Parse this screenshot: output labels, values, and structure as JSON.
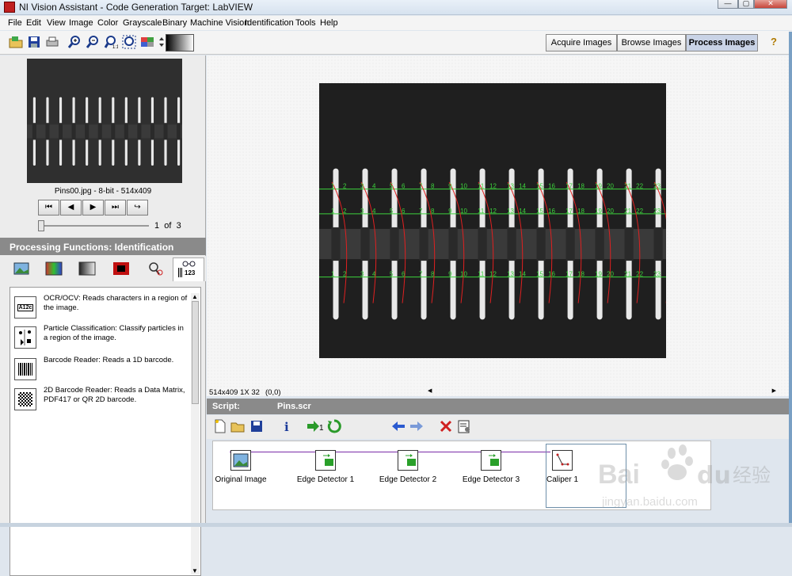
{
  "window": {
    "title": "NI Vision Assistant - Code Generation Target: LabVIEW",
    "min": "—",
    "max": "▢",
    "close": "✕"
  },
  "menu": [
    "File",
    "Edit",
    "View",
    "Image",
    "Color",
    "Grayscale",
    "Binary",
    "Machine Vision",
    "Identification",
    "Tools",
    "Help"
  ],
  "modes": {
    "acquire": "Acquire Images",
    "browse": "Browse Images",
    "process": "Process Images",
    "help": "?"
  },
  "thumbnail": {
    "caption": "Pins00.jpg - 8-bit - 514x409",
    "page_current": "1",
    "page_of": "of",
    "page_total": "3"
  },
  "processing": {
    "header": "Processing Functions: Identification",
    "tab_barcode_label": "123"
  },
  "functions": [
    {
      "icon_label": "A12c",
      "text": "OCR/OCV:  Reads characters in a region of the image."
    },
    {
      "icon_label": "",
      "text": "Particle Classification:  Classify particles in a region of the image."
    },
    {
      "icon_label": "",
      "text": "Barcode Reader:  Reads a 1D barcode."
    },
    {
      "icon_label": "",
      "text": "2D Barcode Reader:  Reads a Data Matrix, PDF417 or QR 2D barcode."
    }
  ],
  "image_status": {
    "info": "514x409 1X 32",
    "coords": "(0,0)"
  },
  "script": {
    "label": "Script:",
    "file": "Pins.scr",
    "step_counter_label": "1"
  },
  "steps": [
    "Original Image",
    "Edge Detector 1",
    "Edge Detector 2",
    "Edge Detector 3",
    "Caliper 1"
  ],
  "pin_labels": [
    [
      "1",
      "2"
    ],
    [
      "3",
      "4"
    ],
    [
      "5",
      "6"
    ],
    [
      "7",
      "8"
    ],
    [
      "9",
      "10"
    ],
    [
      "11",
      "12"
    ],
    [
      "13",
      "14"
    ],
    [
      "15",
      "16"
    ],
    [
      "17",
      "18"
    ],
    [
      "19",
      "20"
    ],
    [
      "21",
      "22"
    ],
    [
      "23"
    ]
  ],
  "colors": {
    "accent_header": "#8a8a8a",
    "measure_green": "#3cd23c",
    "measure_red": "#e02020",
    "active_mode": "#c9d3e6"
  },
  "watermark": {
    "brand": "Bai",
    "brand_cn": "经验",
    "url": "jingyan.baidu.com"
  }
}
